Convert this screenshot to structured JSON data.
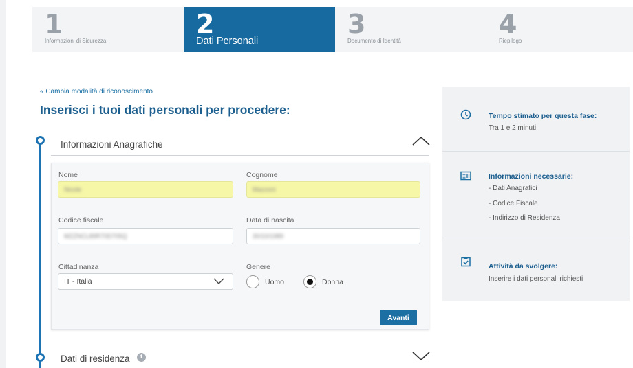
{
  "stepper": {
    "steps": [
      {
        "number": "1",
        "label": "Informazioni di Sicurezza"
      },
      {
        "number": "2",
        "label": "Dati Personali"
      },
      {
        "number": "3",
        "label": "Documento di Identità"
      },
      {
        "number": "4",
        "label": "Riepilogo"
      }
    ],
    "active_step": 2
  },
  "back_link": "« Cambia modalità di riconoscimento",
  "page_title": "Inserisci i tuoi dati personali per procedere:",
  "sections": {
    "anagrafiche": {
      "title": "Informazioni Anagrafiche",
      "expanded": true
    },
    "residenza": {
      "title": "Dati di residenza",
      "expanded": false
    }
  },
  "form": {
    "nome": {
      "label": "Nome",
      "value": "Nicole"
    },
    "cognome": {
      "label": "Cognome",
      "value": "Mazzoni"
    },
    "codice_fiscale": {
      "label": "Codice fiscale",
      "value": "MZZNCL89R70D705Q"
    },
    "data_nascita": {
      "label": "Data di nascita",
      "value": "30/10/1989"
    },
    "cittadinanza": {
      "label": "Cittadinanza",
      "value": "IT - Italia"
    },
    "genere": {
      "label": "Genere",
      "options": [
        "Uomo",
        "Donna"
      ],
      "selected": "Donna"
    },
    "submit_label": "Avanti"
  },
  "side_panel": {
    "tempo": {
      "icon": "clock-icon",
      "title": "Tempo stimato per questa fase:",
      "text": "Tra 1 e 2 minuti"
    },
    "informazioni": {
      "icon": "id-card-icon",
      "title": "Informazioni necessarie:",
      "items": [
        "- Dati Anagrafici",
        "- Codice Fiscale",
        "- Indirizzo di Residenza"
      ]
    },
    "attivita": {
      "icon": "clipboard-check-icon",
      "title": "Attività da svolgere:",
      "text": "Inserire i dati personali richiesti"
    }
  },
  "colors": {
    "accent": "#176a9f",
    "title": "#1c5f8f",
    "timeline": "#1e74b3",
    "autofill": "#f7f7a8"
  }
}
